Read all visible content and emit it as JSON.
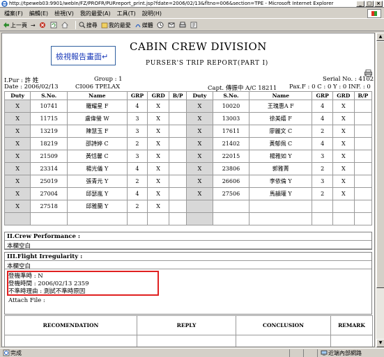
{
  "window": {
    "title": "http://tpeweb03:9901/webIn/FZ/PROFR/PURreport_print.jsp?fdate=2006/02/13&fltno=006&section=TPE - Microsoft Internet Explorer",
    "min": "_",
    "max": "□",
    "close": "×"
  },
  "menu": [
    "檔案(F)",
    "編輯(E)",
    "檢視(V)",
    "我的最愛(A)",
    "工具(T)",
    "說明(H)"
  ],
  "toolbar": {
    "back": "上一頁",
    "forward": "→",
    "search": "搜尋",
    "favorites": "我的最愛",
    "media": "媒體"
  },
  "callout": "檢視報告畫面↵",
  "report": {
    "title": "CABIN CREW DIVISION",
    "subtitle": "PURSER'S TRIP REPORT(PART I)",
    "pur": "I.Pur : 許 姓",
    "group": "Group : 1",
    "serial": "Serial No. : 4102",
    "date": "Date : 2006/02/13",
    "flight": "CI006   TPELAX",
    "captain": "Capt.  傳振中  A/C 18211",
    "pax": "Pax.F : 0   C : 0   Y : 0   INF. : 0"
  },
  "crew_table": {
    "headers": [
      "Duty",
      "S.No.",
      "Name",
      "GRP",
      "GRD",
      "B/P",
      "Duty",
      "S.No.",
      "Name",
      "GRP",
      "GRD",
      "B/P"
    ],
    "rows": [
      [
        "X",
        "10741",
        "羅耀星 F",
        "4",
        "X",
        "",
        "X",
        "10020",
        "王瑰惠A F",
        "4",
        "X",
        ""
      ],
      [
        "X",
        "11715",
        "盧偉螢 W",
        "3",
        "X",
        "",
        "X",
        "13003",
        "徐美嬉 F",
        "4",
        "X",
        ""
      ],
      [
        "X",
        "13219",
        "陳慧玉 F",
        "3",
        "X",
        "",
        "X",
        "17611",
        "廖麗文 C",
        "2",
        "X",
        ""
      ],
      [
        "X",
        "18219",
        "邵詩婷 C",
        "2",
        "X",
        "",
        "X",
        "21402",
        "黃郁佩 C",
        "4",
        "X",
        ""
      ],
      [
        "X",
        "21509",
        "黃恬馨 C",
        "3",
        "X",
        "",
        "X",
        "22015",
        "楊雅如 Y",
        "3",
        "X",
        ""
      ],
      [
        "X",
        "23314",
        "楊光儀 Y",
        "4",
        "X",
        "",
        "X",
        "23806",
        "郭雅菁",
        "2",
        "X",
        ""
      ],
      [
        "X",
        "25019",
        "張青元 Y",
        "2",
        "X",
        "",
        "X",
        "26606",
        "李依倫 Y",
        "3",
        "X",
        ""
      ],
      [
        "X",
        "27004",
        "邱瑟嵐 Y",
        "4",
        "X",
        "",
        "X",
        "27506",
        "馬韻瓘 Y",
        "2",
        "X",
        ""
      ],
      [
        "X",
        "27518",
        "邱雅蘭 Y",
        "2",
        "X",
        "",
        "",
        "",
        "",
        "",
        "",
        ""
      ],
      [
        "",
        "",
        "",
        "",
        "",
        "",
        "",
        "",
        "",
        "",
        "",
        ""
      ]
    ]
  },
  "crew_performance": {
    "title": "II.Crew Performance :",
    "body": "本欄空白"
  },
  "flight_irregularity": {
    "title": "III.Flight Irregularity :",
    "body": "本欄空白",
    "ontime": "登機準時 : N",
    "boarding_time": "登機時間 : 2006/02/13 2359",
    "reason": "不準時理由 : 測試不準時原因",
    "attach": "Attach File :"
  },
  "bottom_headers": [
    "RECOMENDATION",
    "REPLY",
    "CONCLUSION",
    "REMARK"
  ],
  "status": {
    "left": "完成",
    "right": "近端內部網路"
  },
  "colors": {
    "callout_text": "#1838b8",
    "highlight_border": "#e02020",
    "duty_cell": "#d8d8d8"
  }
}
